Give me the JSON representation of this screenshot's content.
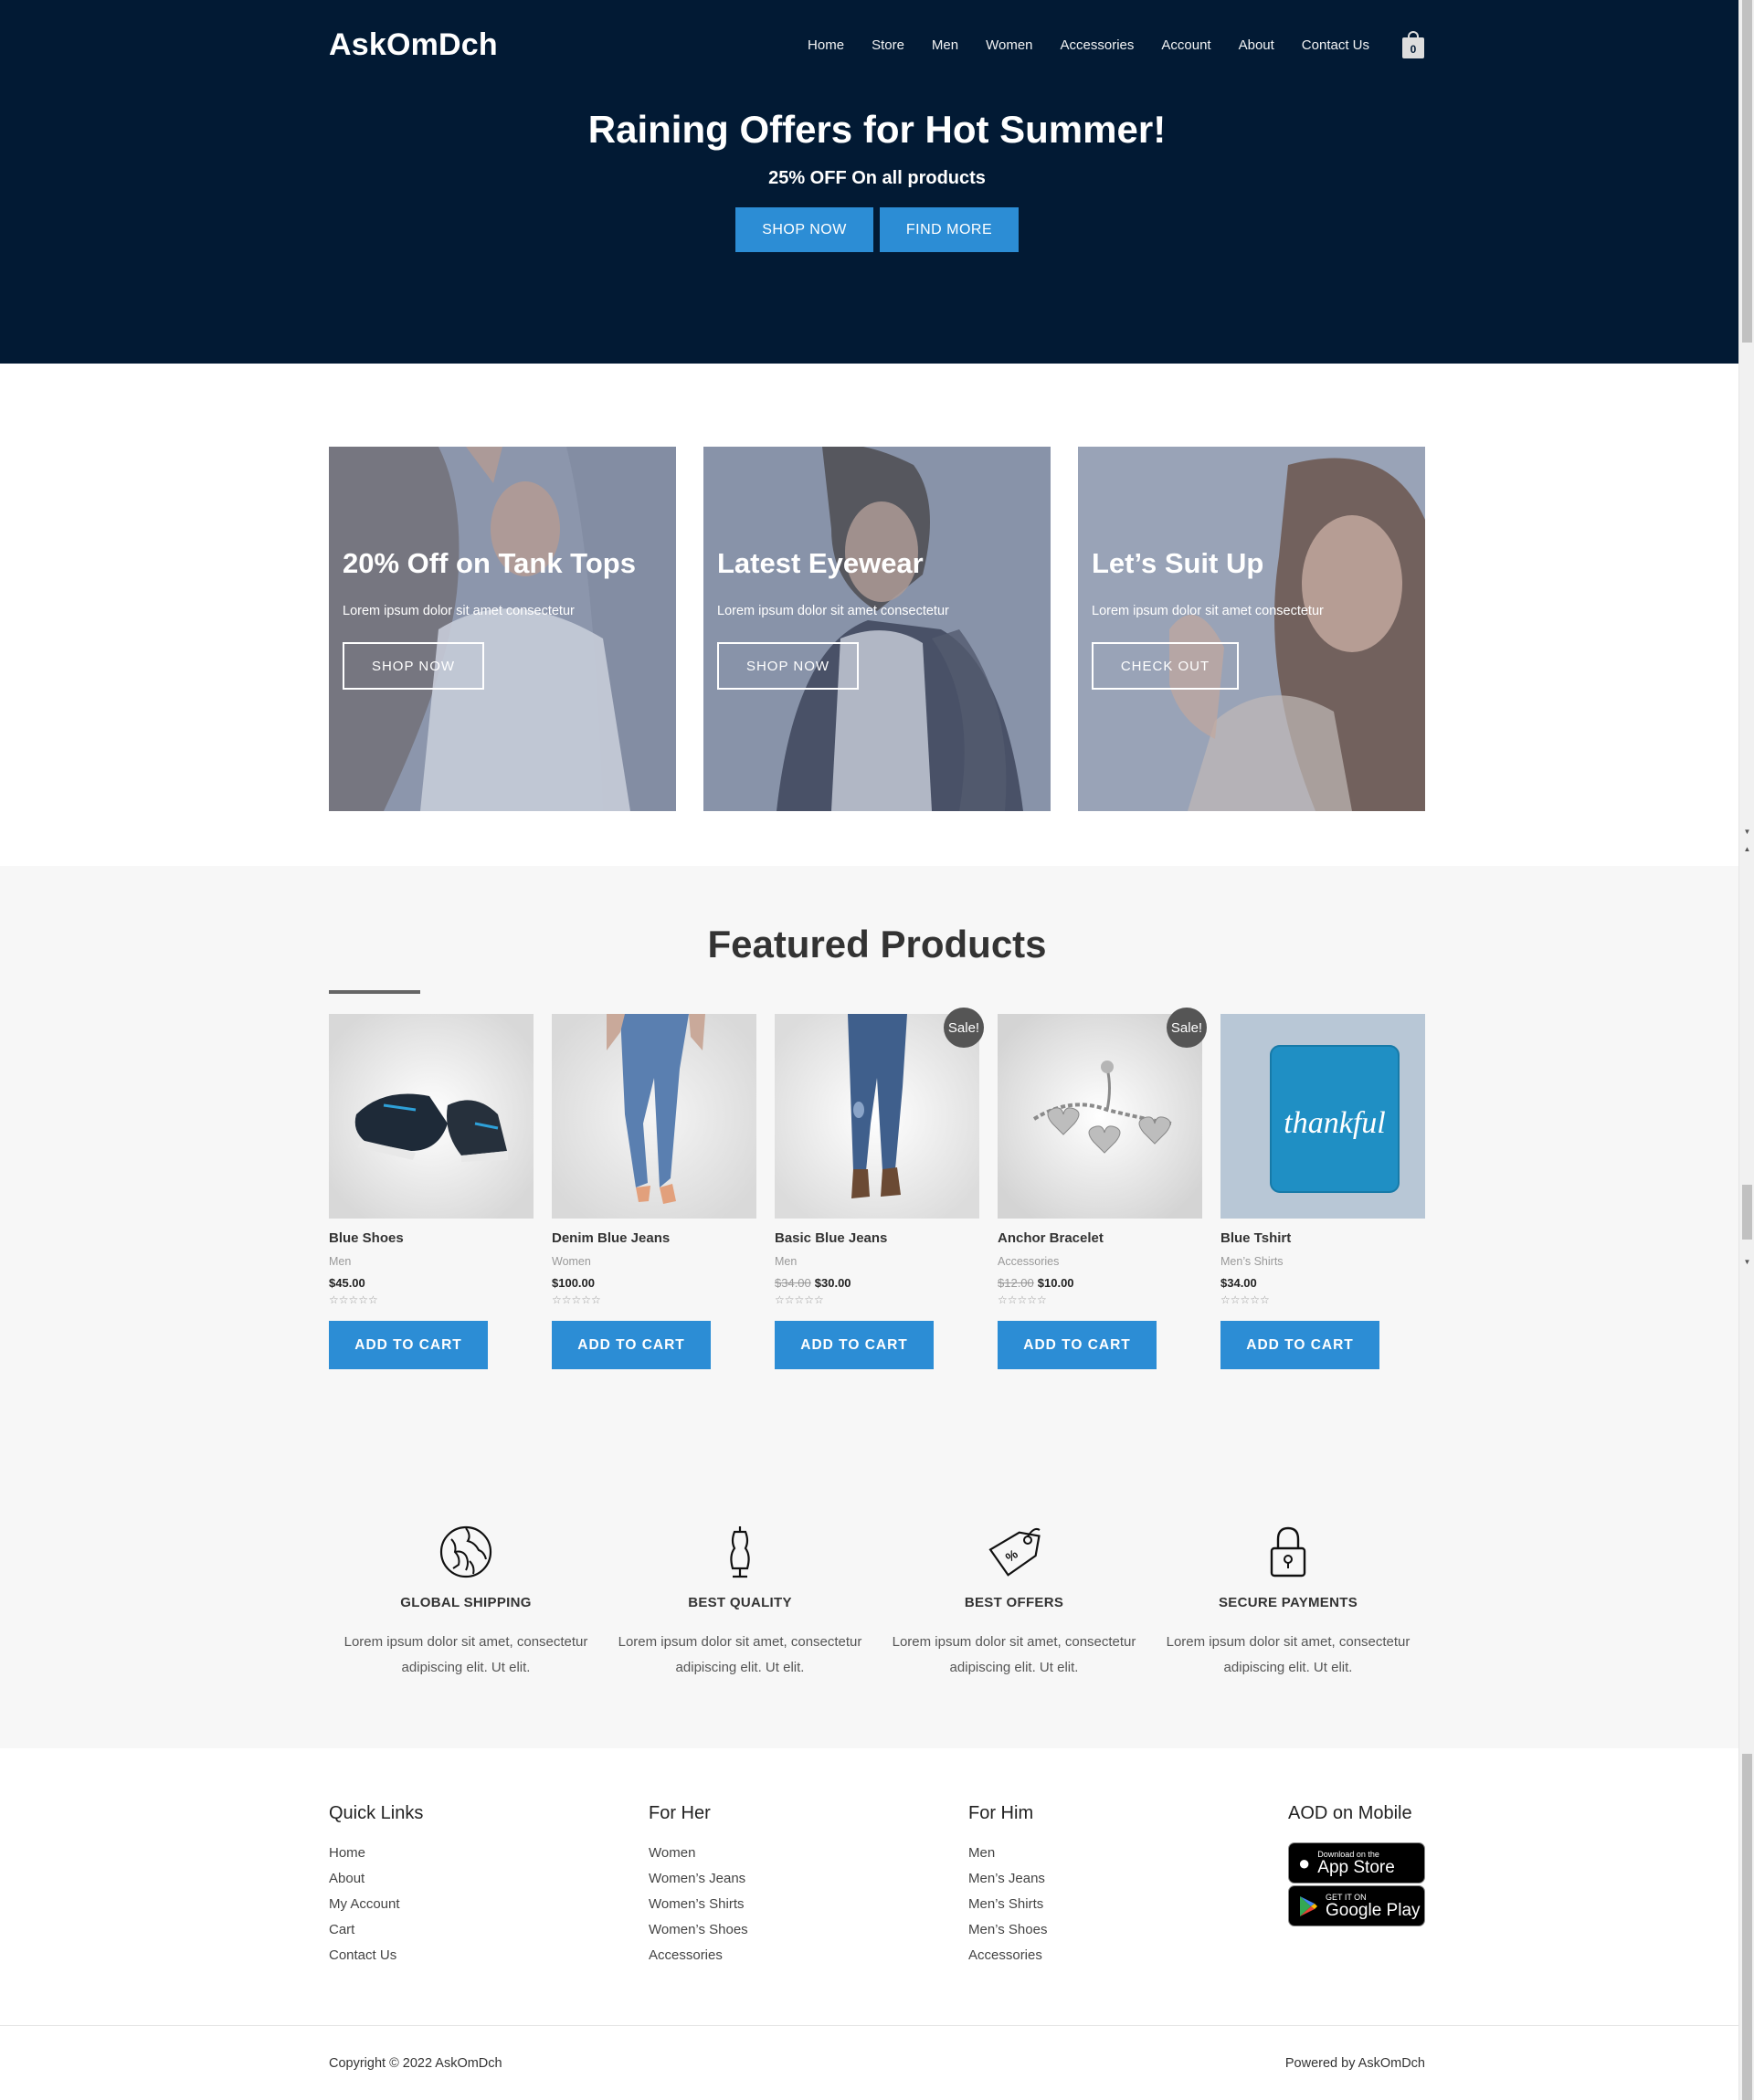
{
  "header": {
    "logo": "AskOmDch",
    "nav": [
      "Home",
      "Store",
      "Men",
      "Women",
      "Accessories",
      "Account",
      "About",
      "Contact Us"
    ],
    "cart_count": "0"
  },
  "hero": {
    "title": "Raining Offers for Hot Summer!",
    "subtitle": "25% OFF On all products",
    "btn_shop": "SHOP NOW",
    "btn_find": "FIND MORE"
  },
  "promos": [
    {
      "title": "20% Off on Tank Tops",
      "text": "Lorem ipsum dolor sit amet consectetur",
      "button": "SHOP NOW"
    },
    {
      "title": "Latest Eyewear",
      "text": "Lorem ipsum dolor sit amet consectetur",
      "button": "SHOP NOW"
    },
    {
      "title": "Let’s Suit Up",
      "text": "Lorem ipsum dolor sit amet consectetur",
      "button": "CHECK OUT"
    }
  ],
  "featured": {
    "title": "Featured Products",
    "sale_label": "Sale!",
    "add_to_cart": "ADD TO CART",
    "products": [
      {
        "name": "Blue Shoes",
        "category": "Men",
        "old_price": "",
        "price": "$45.00",
        "rating": 0
      },
      {
        "name": "Denim Blue Jeans",
        "category": "Women",
        "old_price": "",
        "price": "$100.00",
        "rating": 0
      },
      {
        "name": "Basic Blue Jeans",
        "category": "Men",
        "old_price": "$34.00",
        "price": "$30.00",
        "rating": 0
      },
      {
        "name": "Anchor Bracelet",
        "category": "Accessories",
        "old_price": "$12.00",
        "price": "$10.00",
        "rating": 0
      },
      {
        "name": "Blue Tshirt",
        "category": "Men’s Shirts",
        "old_price": "",
        "price": "$34.00",
        "rating": 0
      }
    ],
    "tshirt_text": "thankful"
  },
  "features": [
    {
      "icon": "globe-icon",
      "title": "GLOBAL SHIPPING",
      "line1": "Lorem ipsum dolor sit amet, consectetur",
      "line2": "adipiscing elit. Ut elit."
    },
    {
      "icon": "mannequin-icon",
      "title": "BEST QUALITY",
      "line1": "Lorem ipsum dolor sit amet, consectetur",
      "line2": "adipiscing elit. Ut elit."
    },
    {
      "icon": "price-tag-icon",
      "title": "BEST OFFERS",
      "line1": "Lorem ipsum dolor sit amet, consectetur",
      "line2": "adipiscing elit. Ut elit."
    },
    {
      "icon": "padlock-icon",
      "title": "SECURE PAYMENTS",
      "line1": "Lorem ipsum dolor sit amet, consectetur",
      "line2": "adipiscing elit. Ut elit."
    }
  ],
  "footer": {
    "quick_links": {
      "title": "Quick Links",
      "items": [
        "Home",
        "About",
        "My Account",
        "Cart",
        "Contact Us"
      ]
    },
    "for_her": {
      "title": "For Her",
      "items": [
        "Women",
        "Women’s Jeans",
        "Women’s Shirts",
        "Women’s Shoes",
        "Accessories"
      ]
    },
    "for_him": {
      "title": "For Him",
      "items": [
        "Men",
        "Men’s Jeans",
        "Men’s Shirts",
        "Men’s Shoes",
        "Accessories"
      ]
    },
    "mobile": {
      "title": "AOD on Mobile",
      "app_store_small": "Download on the",
      "app_store_big": "App Store",
      "google_small": "GET IT ON",
      "google_big": "Google Play"
    },
    "copyright": "Copyright © 2022 AskOmDch",
    "powered": "Powered by AskOmDch"
  },
  "colors": {
    "hero_bg": "#021a34",
    "accent_blue": "#2c8dd5",
    "featured_bg": "#f7f7f7",
    "sale_badge": "#555555"
  }
}
